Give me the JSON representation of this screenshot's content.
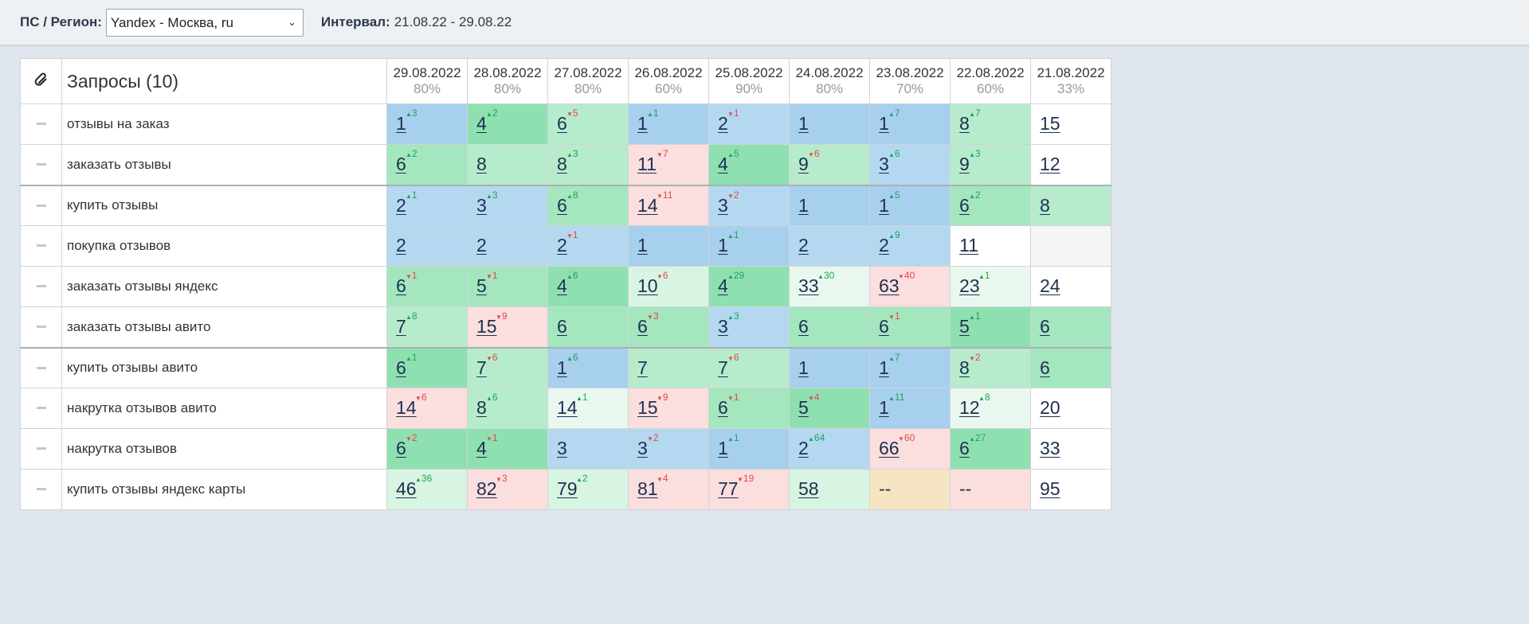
{
  "header": {
    "ps_label": "ПС / Регион:",
    "region_selected": "Yandex - Москва, ru",
    "interval_label": "Интервал:",
    "interval_value": "21.08.22 - 29.08.22"
  },
  "table": {
    "pin_icon": "paperclip-icon",
    "title": "Запросы (10)",
    "columns": [
      {
        "date": "29.08.2022",
        "pct": "80%"
      },
      {
        "date": "28.08.2022",
        "pct": "80%"
      },
      {
        "date": "27.08.2022",
        "pct": "80%"
      },
      {
        "date": "26.08.2022",
        "pct": "60%"
      },
      {
        "date": "25.08.2022",
        "pct": "90%"
      },
      {
        "date": "24.08.2022",
        "pct": "80%"
      },
      {
        "date": "23.08.2022",
        "pct": "70%"
      },
      {
        "date": "22.08.2022",
        "pct": "60%"
      },
      {
        "date": "21.08.2022",
        "pct": "33%"
      }
    ],
    "rows": [
      {
        "name": "отзывы на заказ",
        "cells": [
          {
            "v": "1",
            "d": "up",
            "c": "3",
            "bg": "b1"
          },
          {
            "v": "4",
            "d": "up",
            "c": "2",
            "bg": "g1"
          },
          {
            "v": "6",
            "d": "dn",
            "c": "5",
            "bg": "g3"
          },
          {
            "v": "1",
            "d": "up",
            "c": "1",
            "bg": "b1"
          },
          {
            "v": "2",
            "d": "dn",
            "c": "1",
            "bg": "b2"
          },
          {
            "v": "1",
            "d": "",
            "c": "",
            "bg": "b1"
          },
          {
            "v": "1",
            "d": "up",
            "c": "7",
            "bg": "b1"
          },
          {
            "v": "8",
            "d": "up",
            "c": "7",
            "bg": "g3"
          },
          {
            "v": "15",
            "d": "",
            "c": "",
            "bg": "w"
          }
        ]
      },
      {
        "name": "заказать отзывы",
        "cells": [
          {
            "v": "6",
            "d": "up",
            "c": "2",
            "bg": "g2"
          },
          {
            "v": "8",
            "d": "",
            "c": "",
            "bg": "g3"
          },
          {
            "v": "8",
            "d": "up",
            "c": "3",
            "bg": "g3"
          },
          {
            "v": "11",
            "d": "dn",
            "c": "7",
            "bg": "r"
          },
          {
            "v": "4",
            "d": "up",
            "c": "5",
            "bg": "g1"
          },
          {
            "v": "9",
            "d": "dn",
            "c": "6",
            "bg": "g3"
          },
          {
            "v": "3",
            "d": "up",
            "c": "6",
            "bg": "b2"
          },
          {
            "v": "9",
            "d": "up",
            "c": "3",
            "bg": "g3"
          },
          {
            "v": "12",
            "d": "",
            "c": "",
            "bg": "w"
          }
        ]
      },
      {
        "name": "купить отзывы",
        "cells": [
          {
            "v": "2",
            "d": "up",
            "c": "1",
            "bg": "b2"
          },
          {
            "v": "3",
            "d": "up",
            "c": "3",
            "bg": "b2"
          },
          {
            "v": "6",
            "d": "up",
            "c": "8",
            "bg": "g2"
          },
          {
            "v": "14",
            "d": "dn",
            "c": "11",
            "bg": "r"
          },
          {
            "v": "3",
            "d": "dn",
            "c": "2",
            "bg": "b2"
          },
          {
            "v": "1",
            "d": "",
            "c": "",
            "bg": "b1"
          },
          {
            "v": "1",
            "d": "up",
            "c": "5",
            "bg": "b1"
          },
          {
            "v": "6",
            "d": "up",
            "c": "2",
            "bg": "g2"
          },
          {
            "v": "8",
            "d": "",
            "c": "",
            "bg": "g3"
          }
        ]
      },
      {
        "name": "покупка отзывов",
        "cells": [
          {
            "v": "2",
            "d": "",
            "c": "",
            "bg": "b2"
          },
          {
            "v": "2",
            "d": "",
            "c": "",
            "bg": "b2"
          },
          {
            "v": "2",
            "d": "dn",
            "c": "1",
            "bg": "b2"
          },
          {
            "v": "1",
            "d": "",
            "c": "",
            "bg": "b1"
          },
          {
            "v": "1",
            "d": "up",
            "c": "1",
            "bg": "b1"
          },
          {
            "v": "2",
            "d": "",
            "c": "",
            "bg": "b2"
          },
          {
            "v": "2",
            "d": "up",
            "c": "9",
            "bg": "b2"
          },
          {
            "v": "11",
            "d": "",
            "c": "",
            "bg": "w"
          },
          {
            "v": "",
            "d": "",
            "c": "",
            "bg": "e"
          }
        ]
      },
      {
        "name": "заказать отзывы яндекс",
        "cells": [
          {
            "v": "6",
            "d": "dn",
            "c": "1",
            "bg": "g2"
          },
          {
            "v": "5",
            "d": "dn",
            "c": "1",
            "bg": "g2"
          },
          {
            "v": "4",
            "d": "up",
            "c": "6",
            "bg": "g1"
          },
          {
            "v": "10",
            "d": "dn",
            "c": "6",
            "bg": "g4"
          },
          {
            "v": "4",
            "d": "up",
            "c": "29",
            "bg": "g1"
          },
          {
            "v": "33",
            "d": "up",
            "c": "30",
            "bg": "g5"
          },
          {
            "v": "63",
            "d": "dn",
            "c": "40",
            "bg": "r"
          },
          {
            "v": "23",
            "d": "up",
            "c": "1",
            "bg": "g5"
          },
          {
            "v": "24",
            "d": "",
            "c": "",
            "bg": "w"
          }
        ]
      },
      {
        "name": "заказать отзывы авито",
        "cells": [
          {
            "v": "7",
            "d": "up",
            "c": "8",
            "bg": "g3"
          },
          {
            "v": "15",
            "d": "dn",
            "c": "9",
            "bg": "r"
          },
          {
            "v": "6",
            "d": "",
            "c": "",
            "bg": "g2"
          },
          {
            "v": "6",
            "d": "dn",
            "c": "3",
            "bg": "g2"
          },
          {
            "v": "3",
            "d": "up",
            "c": "3",
            "bg": "b2"
          },
          {
            "v": "6",
            "d": "",
            "c": "",
            "bg": "g2"
          },
          {
            "v": "6",
            "d": "dn",
            "c": "1",
            "bg": "g2"
          },
          {
            "v": "5",
            "d": "up",
            "c": "1",
            "bg": "g1"
          },
          {
            "v": "6",
            "d": "",
            "c": "",
            "bg": "g2"
          }
        ]
      },
      {
        "name": "купить отзывы авито",
        "cells": [
          {
            "v": "6",
            "d": "up",
            "c": "1",
            "bg": "g1"
          },
          {
            "v": "7",
            "d": "dn",
            "c": "6",
            "bg": "g3"
          },
          {
            "v": "1",
            "d": "up",
            "c": "6",
            "bg": "b1"
          },
          {
            "v": "7",
            "d": "",
            "c": "",
            "bg": "g3"
          },
          {
            "v": "7",
            "d": "dn",
            "c": "6",
            "bg": "g3"
          },
          {
            "v": "1",
            "d": "",
            "c": "",
            "bg": "b1"
          },
          {
            "v": "1",
            "d": "up",
            "c": "7",
            "bg": "b1"
          },
          {
            "v": "8",
            "d": "dn",
            "c": "2",
            "bg": "g3"
          },
          {
            "v": "6",
            "d": "",
            "c": "",
            "bg": "g2"
          }
        ]
      },
      {
        "name": "накрутка отзывов авито",
        "cells": [
          {
            "v": "14",
            "d": "dn",
            "c": "6",
            "bg": "r"
          },
          {
            "v": "8",
            "d": "up",
            "c": "6",
            "bg": "g3"
          },
          {
            "v": "14",
            "d": "up",
            "c": "1",
            "bg": "g5"
          },
          {
            "v": "15",
            "d": "dn",
            "c": "9",
            "bg": "r"
          },
          {
            "v": "6",
            "d": "dn",
            "c": "1",
            "bg": "g2"
          },
          {
            "v": "5",
            "d": "dn",
            "c": "4",
            "bg": "g1"
          },
          {
            "v": "1",
            "d": "up",
            "c": "11",
            "bg": "b1"
          },
          {
            "v": "12",
            "d": "up",
            "c": "8",
            "bg": "g5"
          },
          {
            "v": "20",
            "d": "",
            "c": "",
            "bg": "w"
          }
        ]
      },
      {
        "name": "накрутка отзывов",
        "cells": [
          {
            "v": "6",
            "d": "dn",
            "c": "2",
            "bg": "g1"
          },
          {
            "v": "4",
            "d": "dn",
            "c": "1",
            "bg": "g1"
          },
          {
            "v": "3",
            "d": "",
            "c": "",
            "bg": "b2"
          },
          {
            "v": "3",
            "d": "dn",
            "c": "2",
            "bg": "b2"
          },
          {
            "v": "1",
            "d": "up",
            "c": "1",
            "bg": "b1"
          },
          {
            "v": "2",
            "d": "up",
            "c": "64",
            "bg": "b2"
          },
          {
            "v": "66",
            "d": "dn",
            "c": "60",
            "bg": "r"
          },
          {
            "v": "6",
            "d": "up",
            "c": "27",
            "bg": "g1"
          },
          {
            "v": "33",
            "d": "",
            "c": "",
            "bg": "w"
          }
        ]
      },
      {
        "name": "купить отзывы яндекс карты",
        "cells": [
          {
            "v": "46",
            "d": "up",
            "c": "36",
            "bg": "g4"
          },
          {
            "v": "82",
            "d": "dn",
            "c": "3",
            "bg": "r"
          },
          {
            "v": "79",
            "d": "up",
            "c": "2",
            "bg": "g4"
          },
          {
            "v": "81",
            "d": "dn",
            "c": "4",
            "bg": "r"
          },
          {
            "v": "77",
            "d": "dn",
            "c": "19",
            "bg": "r"
          },
          {
            "v": "58",
            "d": "",
            "c": "",
            "bg": "g4"
          },
          {
            "v": "--",
            "d": "",
            "c": "",
            "bg": "y",
            "nolink": true
          },
          {
            "v": "--",
            "d": "",
            "c": "",
            "bg": "r",
            "nolink": true
          },
          {
            "v": "95",
            "d": "",
            "c": "",
            "bg": "w"
          }
        ]
      }
    ]
  }
}
